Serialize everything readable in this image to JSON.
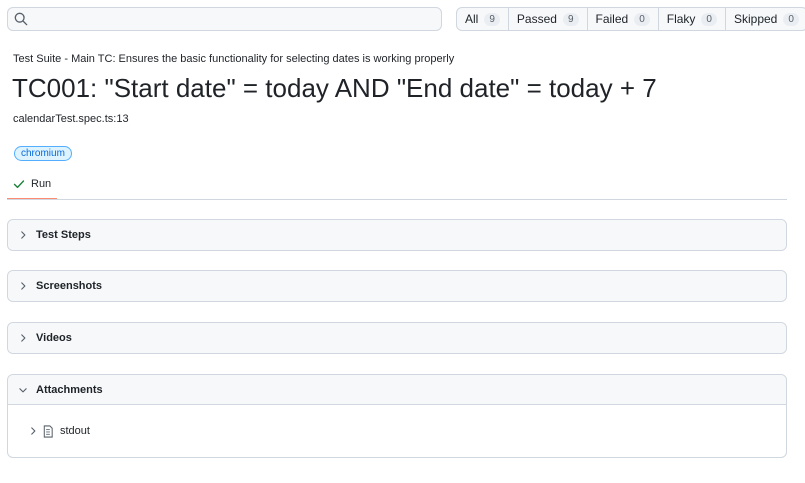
{
  "search": {
    "value": "",
    "placeholder": ""
  },
  "filters": [
    {
      "label": "All",
      "count": "9"
    },
    {
      "label": "Passed",
      "count": "9"
    },
    {
      "label": "Failed",
      "count": "0"
    },
    {
      "label": "Flaky",
      "count": "0"
    },
    {
      "label": "Skipped",
      "count": "0"
    }
  ],
  "test": {
    "suite_line": "Test Suite - Main TC: Ensures the basic functionality for selecting dates is working properly",
    "title": "TC001: \"Start date\" = today AND \"End date\" = today + 7",
    "location": "calendarTest.spec.ts:13",
    "project": "chromium"
  },
  "tabs": {
    "run_label": "Run"
  },
  "sections": {
    "test_steps": "Test Steps",
    "screenshots": "Screenshots",
    "videos": "Videos",
    "attachments": "Attachments"
  },
  "attachments": [
    {
      "name": "stdout"
    }
  ],
  "icons": {
    "search": "search-icon",
    "check": "check-icon",
    "chevron_right": "chevron-right-icon",
    "chevron_down": "chevron-down-icon",
    "file": "file-icon"
  },
  "colors": {
    "border": "#d0d7de",
    "header_bg": "#f6f8fa",
    "badge_bg": "#ddf4ff",
    "badge_border": "#54aeff",
    "badge_text": "#0969da",
    "tab_underline": "#fd8c73",
    "pass_check": "#1a7f37"
  }
}
